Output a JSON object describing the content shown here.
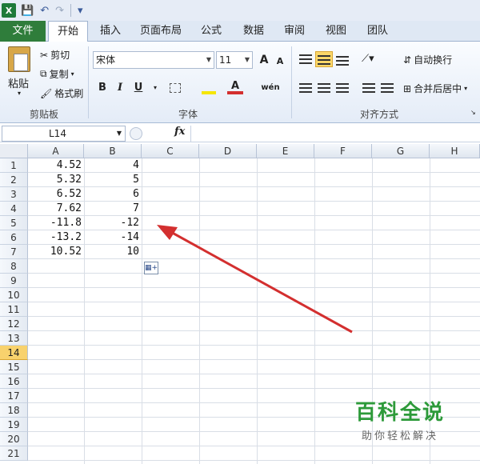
{
  "qat": {
    "logo": "X",
    "save": "💾",
    "undo": "↶",
    "redo": "↷",
    "customize": "▾"
  },
  "tabs": [
    "文件",
    "开始",
    "插入",
    "页面布局",
    "公式",
    "数据",
    "审阅",
    "视图",
    "团队"
  ],
  "ribbon": {
    "clipboard": {
      "paste": "粘贴",
      "cut": "剪切",
      "copy": "复制",
      "format_painter": "格式刷",
      "label": "剪贴板"
    },
    "font": {
      "name": "宋体",
      "size": "11",
      "grow": "A",
      "shrink": "A",
      "bold": "B",
      "italic": "I",
      "underline": "U",
      "phonetic": "wén",
      "label": "字体"
    },
    "alignment": {
      "wrap": "自动换行",
      "merge": "合并后居中",
      "label": "对齐方式"
    }
  },
  "formula_bar": {
    "name_box": "L14",
    "fx": "fx",
    "value": ""
  },
  "columns": [
    "A",
    "B",
    "C",
    "D",
    "E",
    "F",
    "G",
    "H"
  ],
  "rows": [
    "1",
    "2",
    "3",
    "4",
    "5",
    "6",
    "7",
    "8",
    "9",
    "10",
    "11",
    "12",
    "13",
    "14",
    "15",
    "16",
    "17",
    "18",
    "19",
    "20",
    "21"
  ],
  "selected_row": "14",
  "cells": {
    "A": [
      "4.52",
      "5.32",
      "6.52",
      "7.62",
      "-11.8",
      "-13.2",
      "10.52"
    ],
    "B": [
      "4",
      "5",
      "6",
      "7",
      "-12",
      "-14",
      "10"
    ]
  },
  "watermark": {
    "title": "百科全说",
    "subtitle": "助你轻松解决"
  },
  "colors": {
    "accent": "#2f7d3b",
    "arrow": "#d32f2f",
    "selection": "#f8d26d"
  }
}
